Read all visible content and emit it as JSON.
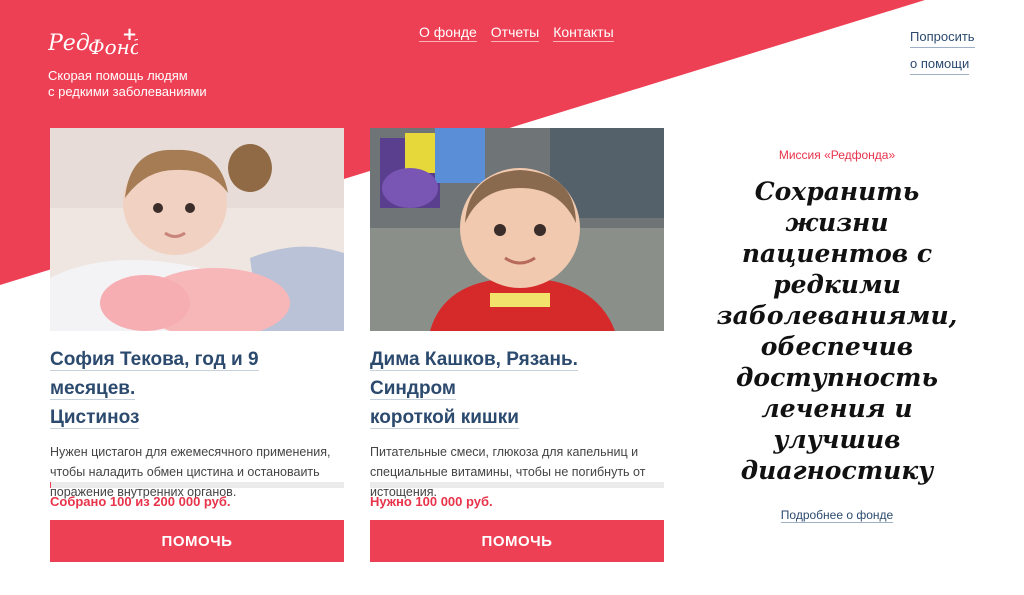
{
  "brand": {
    "logo_text": "РедФонд+",
    "tagline_line1": "Скорая помощь людям",
    "tagline_line2": "с редкими заболеваниями"
  },
  "nav": {
    "items": [
      {
        "label": "О фонде"
      },
      {
        "label": "Отчеты"
      },
      {
        "label": "Контакты"
      }
    ],
    "ask_help_line1": "Попросить",
    "ask_help_line2": "о помощи"
  },
  "cards": [
    {
      "title_line1": "София Текова, год и 9 месяцев.",
      "title_line2": "Цистиноз",
      "description": "Нужен цистагон для ежемесячного применения, чтобы наладить обмен цистина и остановаить поражение внутренних органов.",
      "raised_text": "Собрано 100 из 200 000 руб.",
      "progress": 0.0005,
      "button_label": "ПОМОЧЬ"
    },
    {
      "title_line1": "Дима Кашков, Рязань. Синдром",
      "title_line2": "короткой кишки",
      "description": "Питательные смеси, глюкоза для капельниц и специальные витамины, чтобы не погибнуть от истощения.",
      "raised_text": "Нужно 100 000 руб.",
      "progress": 0,
      "button_label": "ПОМОЧЬ"
    }
  ],
  "mission": {
    "label": "Миссия «Редфонда»",
    "text": "Сохранить жизни пациентов с редкими заболеваниями, обеспечив доступность лечения и улучшив диагностику",
    "more_link": "Подробнее о фонде"
  },
  "colors": {
    "brand_red": "#ee4055",
    "link_blue": "#2b4a6e",
    "text_red": "#e8334a"
  }
}
